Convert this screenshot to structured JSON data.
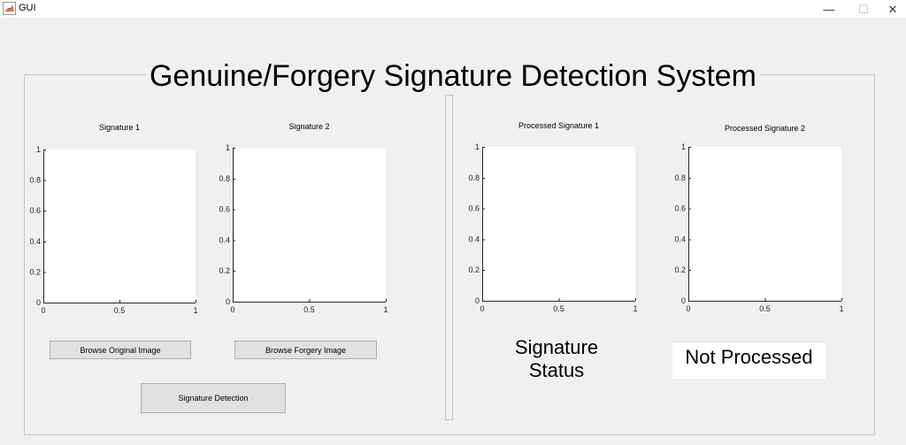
{
  "window": {
    "title": "GUI",
    "minimize_glyph": "—",
    "maximize_glyph": "☐",
    "close_glyph": "✕",
    "app_icon": "matlab-icon"
  },
  "main": {
    "title": "Genuine/Forgery Signature Detection System"
  },
  "axes": [
    {
      "id": "sig1",
      "title": "Signature 1",
      "xticks": [
        "0",
        "0.5",
        "1"
      ],
      "yticks": [
        "0",
        "0.2",
        "0.4",
        "0.6",
        "0.8",
        "1"
      ],
      "xlim": [
        0,
        1
      ],
      "ylim": [
        0,
        1
      ]
    },
    {
      "id": "sig2",
      "title": "Signature 2",
      "xticks": [
        "0",
        "0.5",
        "1"
      ],
      "yticks": [
        "0",
        "0.2",
        "0.4",
        "0.6",
        "0.8",
        "1"
      ],
      "xlim": [
        0,
        1
      ],
      "ylim": [
        0,
        1
      ]
    },
    {
      "id": "proc1",
      "title": "Processed Signature 1",
      "xticks": [
        "0",
        "0.5",
        "1"
      ],
      "yticks": [
        "0",
        "0.2",
        "0.4",
        "0.6",
        "0.8",
        "1"
      ],
      "xlim": [
        0,
        1
      ],
      "ylim": [
        0,
        1
      ]
    },
    {
      "id": "proc2",
      "title": "Processed Signature 2",
      "xticks": [
        "0",
        "0.5",
        "1"
      ],
      "yticks": [
        "0",
        "0.2",
        "0.4",
        "0.6",
        "0.8",
        "1"
      ],
      "xlim": [
        0,
        1
      ],
      "ylim": [
        0,
        1
      ]
    }
  ],
  "buttons": {
    "browse_original": "Browse Original Image",
    "browse_forgery": "Browse Forgery Image",
    "signature_detection": "Signature Detection"
  },
  "status": {
    "label_line1": "Signature",
    "label_line2": "Status",
    "value": "Not Processed"
  },
  "colors": {
    "background": "#f0f0f0",
    "plot_background": "#ffffff",
    "button_face": "#e1e1e1"
  }
}
